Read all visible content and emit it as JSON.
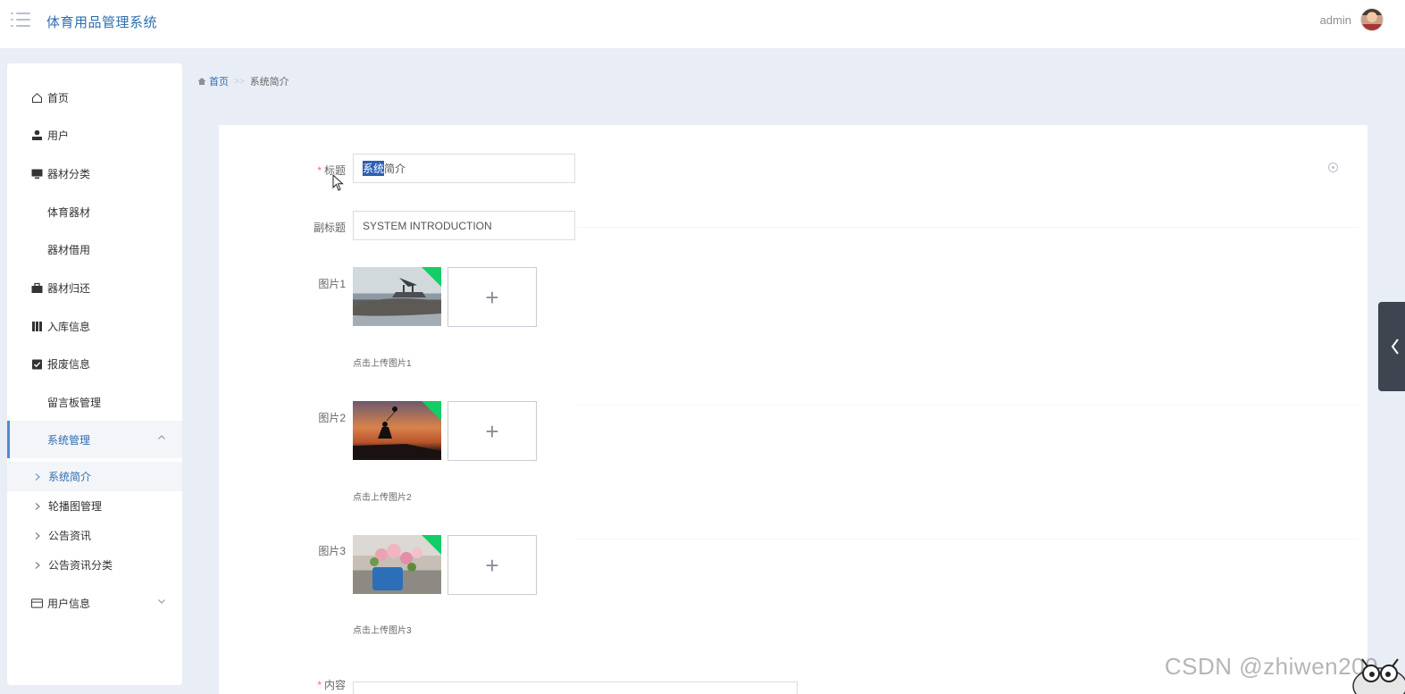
{
  "header": {
    "app_title": "体育用品管理系统",
    "user_name": "admin"
  },
  "sidebar": {
    "items": [
      {
        "label": "首页",
        "icon": "home-icon"
      },
      {
        "label": "用户",
        "icon": "user-icon"
      },
      {
        "label": "器材分类",
        "icon": "monitor-icon"
      },
      {
        "label": "体育器材",
        "icon": "grid-icon"
      },
      {
        "label": "器材借用",
        "icon": "grid-icon"
      },
      {
        "label": "器材归还",
        "icon": "briefcase-icon"
      },
      {
        "label": "入库信息",
        "icon": "book-icon"
      },
      {
        "label": "报废信息",
        "icon": "clipboard-check-icon"
      },
      {
        "label": "留言板管理",
        "icon": "grid-icon"
      },
      {
        "label": "系统管理",
        "icon": "grid-icon",
        "active": true,
        "expanded": true
      },
      {
        "label": "用户信息",
        "icon": "card-icon",
        "expanded": false
      }
    ],
    "submenu": [
      {
        "label": "系统简介",
        "active": true
      },
      {
        "label": "轮播图管理"
      },
      {
        "label": "公告资讯"
      },
      {
        "label": "公告资讯分类"
      }
    ]
  },
  "breadcrumb": {
    "home": "首页",
    "separator": ">>",
    "current": "系统简介"
  },
  "form": {
    "title_label": "标题",
    "title_value_selected": "系统",
    "title_value_rest": "简介",
    "subtitle_label": "副标题",
    "subtitle_value": "SYSTEM INTRODUCTION",
    "image1_label": "图片1",
    "image1_hint": "点击上传图片1",
    "image2_label": "图片2",
    "image2_hint": "点击上传图片2",
    "image3_label": "图片3",
    "image3_hint": "点击上传图片3",
    "content_label": "内容",
    "required_mark": "*",
    "upload_plus": "+"
  },
  "watermark": "CSDN @zhiwen200",
  "colors": {
    "accent": "#2f6fb1",
    "active_border": "#4d8bd5",
    "required": "#f56c6c",
    "upload_success": "#13ce66",
    "page_bg": "#e9edf5"
  }
}
